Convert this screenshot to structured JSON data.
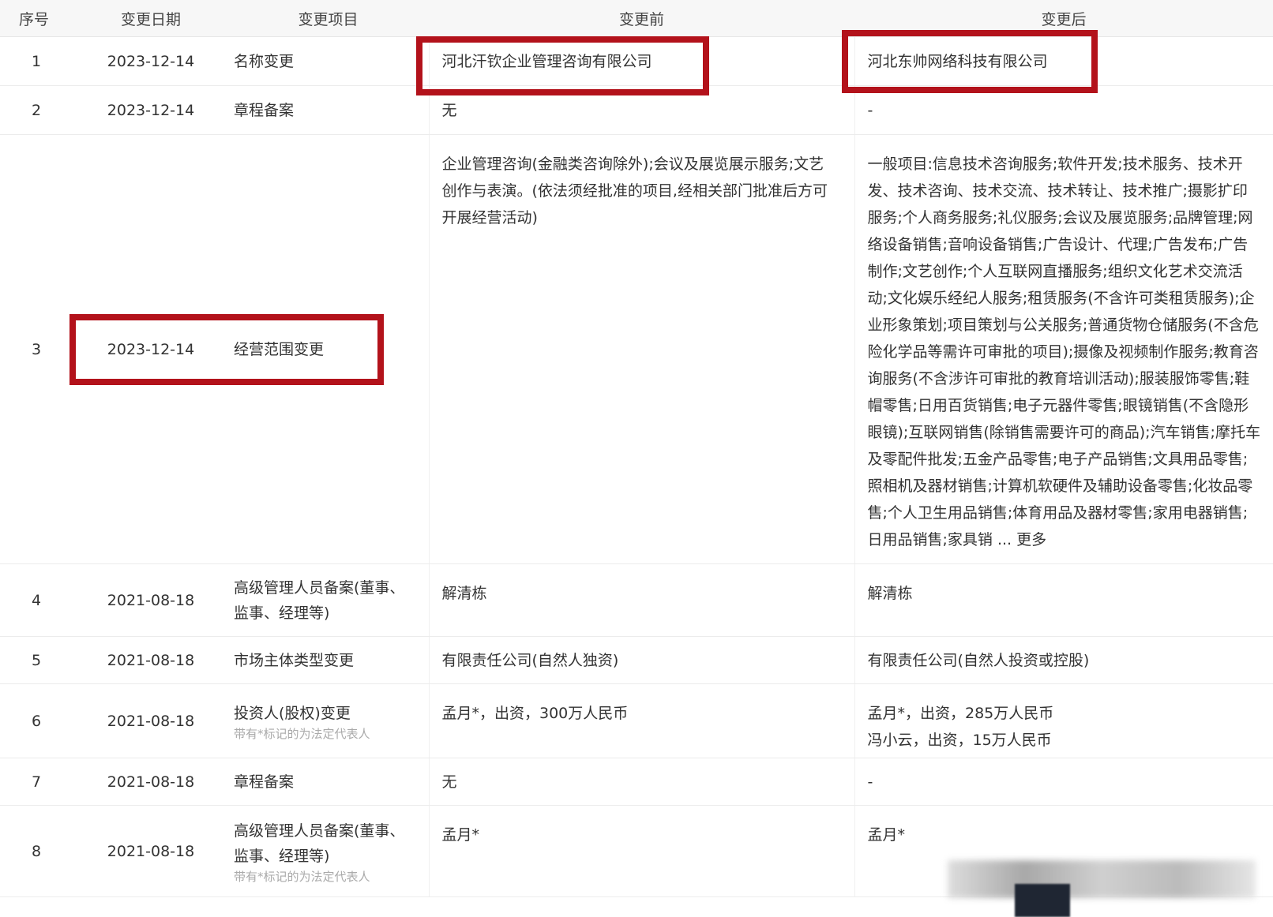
{
  "headers": {
    "idx": "序号",
    "date": "变更日期",
    "item": "变更项目",
    "before": "变更前",
    "after": "变更后"
  },
  "rows": [
    {
      "idx": "1",
      "date": "2023-12-14",
      "item": "名称变更",
      "before": "河北汗钦企业管理咨询有限公司",
      "after": "河北东帅网络科技有限公司"
    },
    {
      "idx": "2",
      "date": "2023-12-14",
      "item": "章程备案",
      "before": "无",
      "after": "-"
    },
    {
      "idx": "3",
      "date": "2023-12-14",
      "item": "经营范围变更",
      "before": "企业管理咨询(金融类咨询除外);会议及展览展示服务;文艺创作与表演。(依法须经批准的项目,经相关部门批准后方可开展经营活动)",
      "after": "一般项目:信息技术咨询服务;软件开发;技术服务、技术开发、技术咨询、技术交流、技术转让、技术推广;摄影扩印服务;个人商务服务;礼仪服务;会议及展览服务;品牌管理;网络设备销售;音响设备销售;广告设计、代理;广告发布;广告制作;文艺创作;个人互联网直播服务;组织文化艺术交流活动;文化娱乐经纪人服务;租赁服务(不含许可类租赁服务);企业形象策划;项目策划与公关服务;普通货物仓储服务(不含危险化学品等需许可审批的项目);摄像及视频制作服务;教育咨询服务(不含涉许可审批的教育培训活动);服装服饰零售;鞋帽零售;日用百货销售;电子元器件零售;眼镜销售(不含隐形眼镜);互联网销售(除销售需要许可的商品);汽车销售;摩托车及零配件批发;五金产品零售;电子产品销售;文具用品零售;照相机及器材销售;计算机软硬件及辅助设备零售;化妆品零售;个人卫生用品销售;体育用品及器材零售;家用电器销售;日用品销售;家具销",
      "more": "... 更多"
    },
    {
      "idx": "4",
      "date": "2021-08-18",
      "item": "高级管理人员备案(董事、监事、经理等)",
      "before": "解清栋",
      "after": "解清栋"
    },
    {
      "idx": "5",
      "date": "2021-08-18",
      "item": "市场主体类型变更",
      "before": "有限责任公司(自然人独资)",
      "after": "有限责任公司(自然人投资或控股)"
    },
    {
      "idx": "6",
      "date": "2021-08-18",
      "item": "投资人(股权)变更",
      "item_note": "带有*标记的为法定代表人",
      "before": "孟月*，出资，300万人民币",
      "after_lines": [
        "孟月*，出资，285万人民币",
        "冯小云，出资，15万人民币"
      ]
    },
    {
      "idx": "7",
      "date": "2021-08-18",
      "item": "章程备案",
      "before": "无",
      "after": "-"
    },
    {
      "idx": "8",
      "date": "2021-08-18",
      "item": "高级管理人员备案(董事、监事、经理等)",
      "item_note": "带有*标记的为法定代表人",
      "before": "孟月*",
      "after": "孟月*"
    }
  ],
  "highlight_color": "#b3121b"
}
